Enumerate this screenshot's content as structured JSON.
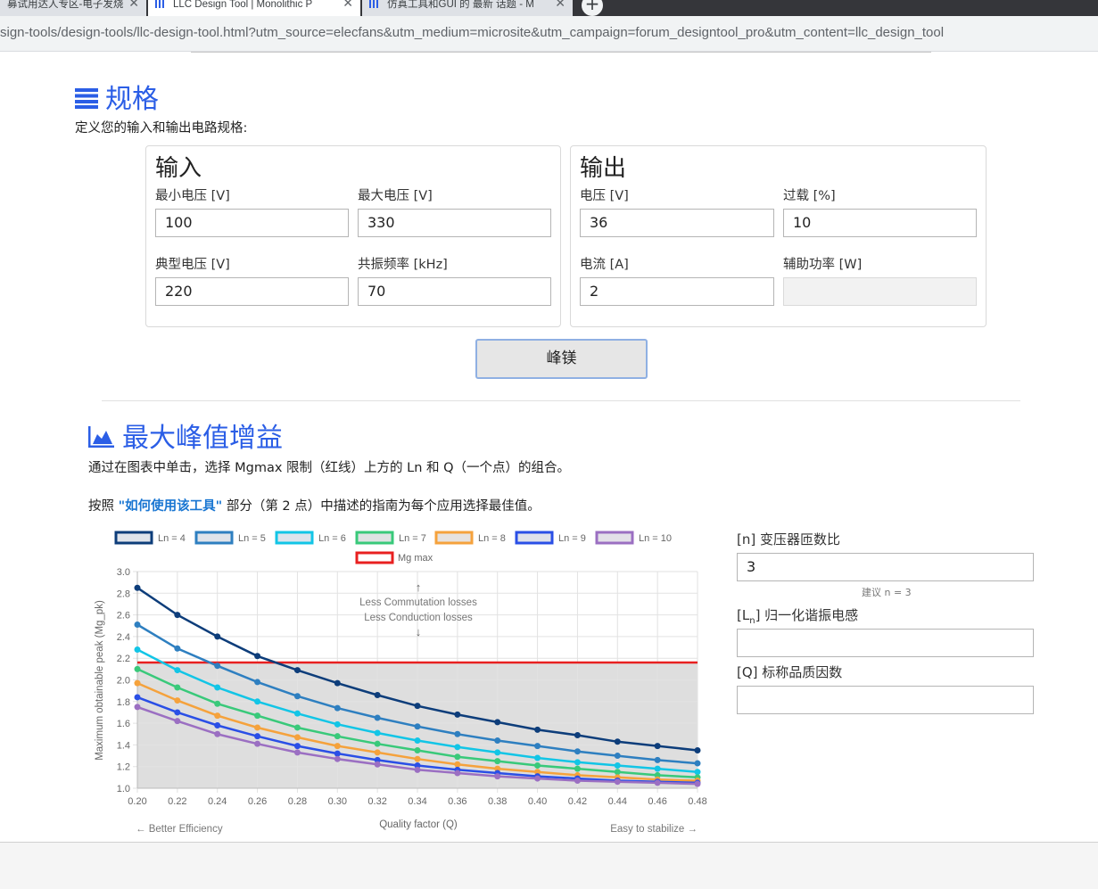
{
  "browser": {
    "tabs": [
      {
        "title": "募试用达人专区-电子发烧",
        "state": "inactive"
      },
      {
        "title": "LLC Design Tool | Monolithic P",
        "state": "active"
      },
      {
        "title": "仿真工具和GUI 的 最新 话题 - M",
        "state": "inactive"
      }
    ],
    "new_tab": "+",
    "url": "sign-tools/design-tools/llc-design-tool.html?utm_source=elecfans&utm_medium=microsite&utm_campaign=forum_designtool_pro&utm_content=llc_design_tool"
  },
  "spec": {
    "title": "规格",
    "description": "定义您的输入和输出电路规格:",
    "input_panel": {
      "title": "输入",
      "min_voltage_label": "最小电压 [V]",
      "min_voltage": "100",
      "max_voltage_label": "最大电压 [V]",
      "max_voltage": "330",
      "typ_voltage_label": "典型电压 [V]",
      "typ_voltage": "220",
      "res_freq_label": "共振频率 [kHz]",
      "res_freq": "70"
    },
    "output_panel": {
      "title": "输出",
      "voltage_label": "电压 [V]",
      "voltage": "36",
      "overload_label": "过载 [%]",
      "overload": "10",
      "current_label": "电流 [A]",
      "current": "2",
      "aux_power_label": "辅助功率 [W]",
      "aux_power": ""
    },
    "button_label": "峰镁"
  },
  "gain": {
    "title": "最大峰值增益",
    "desc1": "通过在图表中单击，选择 Mgmax 限制（红线）上方的 Ln 和 Q（一个点）的组合。",
    "desc2_pre": "按照 ",
    "desc2_link": "\"如何使用该工具\"",
    "desc2_post": " 部分（第 2 点）中描述的指南为每个应用选择最佳值。"
  },
  "params": {
    "n_label": "[n] 变压器匝数比",
    "n_value": "3",
    "n_hint": "建议 n = 3",
    "ln_label_pre": "[L",
    "ln_label_sub": "n",
    "ln_label_post": "] 归一化谐振电感",
    "ln_value": "",
    "q_label": "[Q] 标称品质因数",
    "q_value": ""
  },
  "chart_data": {
    "type": "line",
    "title": "",
    "xlabel": "Quality factor (Q)",
    "ylabel": "Maximum obtainable peak (Mg_pk)",
    "xlim": [
      0.2,
      0.48
    ],
    "ylim": [
      1.0,
      3.0
    ],
    "x_ticks": [
      "0.20",
      "0.22",
      "0.24",
      "0.26",
      "0.28",
      "0.30",
      "0.32",
      "0.34",
      "0.36",
      "0.38",
      "0.40",
      "0.42",
      "0.44",
      "0.46",
      "0.48"
    ],
    "y_ticks": [
      "1.0",
      "1.2",
      "1.4",
      "1.6",
      "1.8",
      "2.0",
      "2.2",
      "2.4",
      "2.6",
      "2.8",
      "3.0"
    ],
    "grid": true,
    "legend_position": "top",
    "x": [
      0.2,
      0.22,
      0.24,
      0.26,
      0.28,
      0.3,
      0.32,
      0.34,
      0.36,
      0.38,
      0.4,
      0.42,
      0.44,
      0.46,
      0.48
    ],
    "series": [
      {
        "name": "Ln = 4",
        "color": "#0d3d7a",
        "fill": "#dfe3ea",
        "values": [
          2.85,
          2.6,
          2.4,
          2.22,
          2.09,
          1.97,
          1.86,
          1.76,
          1.68,
          1.61,
          1.54,
          1.49,
          1.43,
          1.39,
          1.35
        ]
      },
      {
        "name": "Ln = 5",
        "color": "#2e7fc0",
        "fill": "#dfe3ea",
        "values": [
          2.51,
          2.29,
          2.13,
          1.98,
          1.85,
          1.74,
          1.65,
          1.57,
          1.5,
          1.44,
          1.39,
          1.34,
          1.3,
          1.26,
          1.23
        ]
      },
      {
        "name": "Ln = 6",
        "color": "#12c5e6",
        "fill": "#dde4ec",
        "values": [
          2.28,
          2.09,
          1.93,
          1.8,
          1.69,
          1.59,
          1.51,
          1.44,
          1.38,
          1.33,
          1.28,
          1.24,
          1.21,
          1.18,
          1.15
        ]
      },
      {
        "name": "Ln = 7",
        "color": "#39c97a",
        "fill": "#dfe3e3",
        "values": [
          2.1,
          1.93,
          1.78,
          1.67,
          1.56,
          1.48,
          1.41,
          1.35,
          1.29,
          1.25,
          1.21,
          1.18,
          1.15,
          1.12,
          1.1
        ]
      },
      {
        "name": "Ln = 8",
        "color": "#f5a23c",
        "fill": "#e6e2df",
        "values": [
          1.97,
          1.81,
          1.67,
          1.56,
          1.47,
          1.39,
          1.33,
          1.27,
          1.22,
          1.18,
          1.15,
          1.12,
          1.1,
          1.08,
          1.07
        ]
      },
      {
        "name": "Ln = 9",
        "color": "#2a4fe6",
        "fill": "#dfe1ea",
        "values": [
          1.84,
          1.7,
          1.58,
          1.48,
          1.39,
          1.32,
          1.26,
          1.21,
          1.17,
          1.14,
          1.11,
          1.09,
          1.07,
          1.06,
          1.05
        ]
      },
      {
        "name": "Ln = 10",
        "color": "#9b6fc2",
        "fill": "#e3e0e8",
        "values": [
          1.75,
          1.62,
          1.5,
          1.41,
          1.33,
          1.27,
          1.22,
          1.17,
          1.14,
          1.11,
          1.09,
          1.07,
          1.06,
          1.05,
          1.04
        ]
      }
    ],
    "mg_max": {
      "name": "Mg max",
      "color": "#e82020",
      "value": 2.16
    },
    "annotations": {
      "up_arrow": "↑",
      "line1": "Less Commutation losses",
      "line2": "Less Conduction losses",
      "down_arrow": "↓",
      "left": "← Better Efficiency",
      "right": "Easy to stabilize →"
    }
  }
}
